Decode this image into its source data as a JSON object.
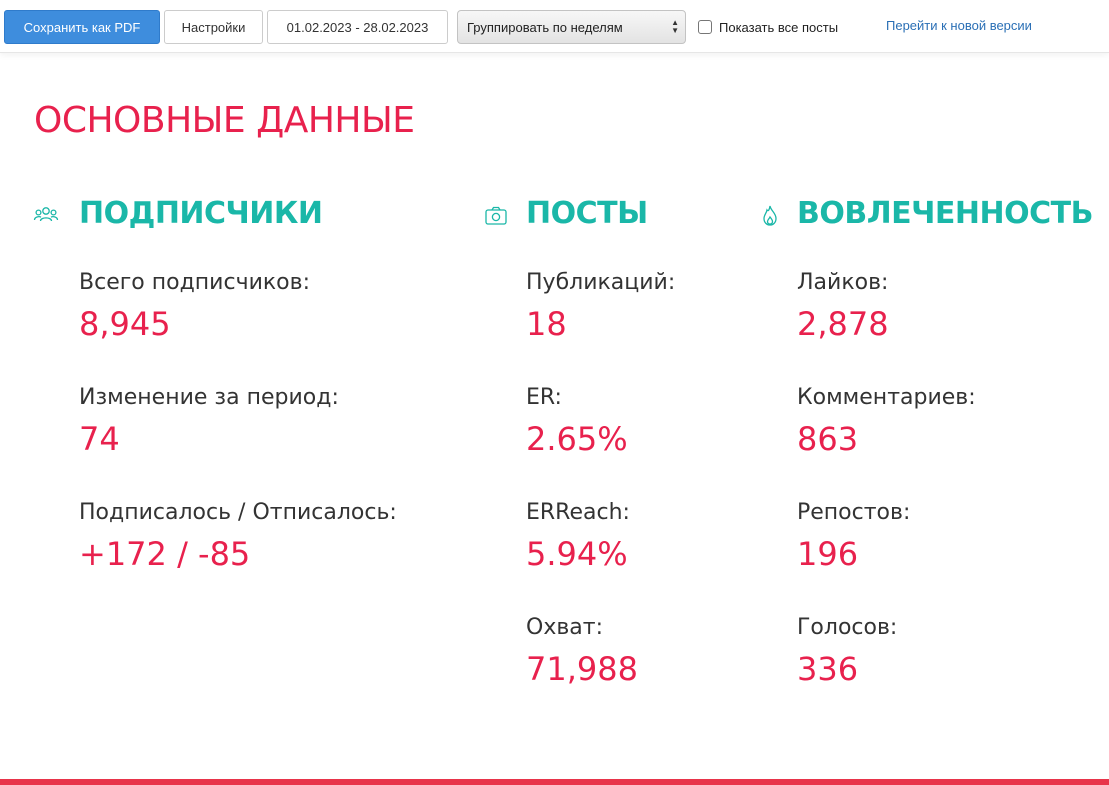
{
  "toolbar": {
    "save_pdf_label": "Сохранить как PDF",
    "settings_label": "Настройки",
    "date_range": "01.02.2023 - 28.02.2023",
    "group_by_selected": "Группировать по неделям",
    "show_all_posts_label": "Показать все посты",
    "show_all_posts_checked": false,
    "new_version_link": "Перейти к новой версии"
  },
  "main": {
    "title": "ОСНОВНЫЕ ДАННЫЕ",
    "sections": [
      {
        "title": "ПОДПИСЧИКИ",
        "icon": "users-icon",
        "metrics": [
          {
            "label": "Всего подписчиков:",
            "value": "8,945"
          },
          {
            "label": "Изменение за период:",
            "value": "74"
          },
          {
            "label": "Подписалось / Отписалось:",
            "value": "+172 / -85"
          }
        ]
      },
      {
        "title": "ПОСТЫ",
        "icon": "camera-icon",
        "metrics": [
          {
            "label": "Публикаций:",
            "value": "18"
          },
          {
            "label": "ER:",
            "value": "2.65%"
          },
          {
            "label": "ERReach:",
            "value": "5.94%"
          },
          {
            "label": "Охват:",
            "value": "71,988"
          }
        ]
      },
      {
        "title": "ВОВЛЕЧЕННОСТЬ",
        "icon": "flame-icon",
        "metrics": [
          {
            "label": "Лайков:",
            "value": "2,878"
          },
          {
            "label": "Комментариев:",
            "value": "863"
          },
          {
            "label": "Репостов:",
            "value": "196"
          },
          {
            "label": "Голосов:",
            "value": "336"
          }
        ]
      }
    ]
  },
  "colors": {
    "accent_red": "#e8214d",
    "accent_teal": "#1ab7a8",
    "primary_button": "#3e8ddd",
    "link": "#2a6fb5"
  }
}
